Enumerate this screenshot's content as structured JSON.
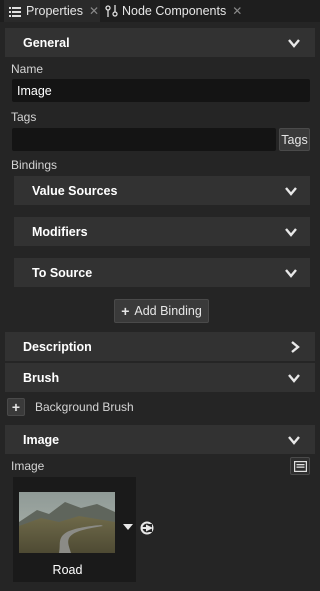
{
  "tabs": [
    {
      "label": "Properties"
    },
    {
      "label": "Node Components"
    }
  ],
  "sections": {
    "general": "General",
    "description": "Description",
    "brush": "Brush",
    "image": "Image"
  },
  "general": {
    "name_label": "Name",
    "name_value": "Image",
    "tags_label": "Tags",
    "tags_value": "",
    "tags_button": "Tags",
    "bindings_label": "Bindings",
    "binding_groups": [
      "Value Sources",
      "Modifiers",
      "To Source"
    ],
    "add_binding_label": "Add Binding"
  },
  "brush": {
    "background_brush_label": "Background Brush"
  },
  "image": {
    "image_label": "Image",
    "asset_name": "Road"
  }
}
